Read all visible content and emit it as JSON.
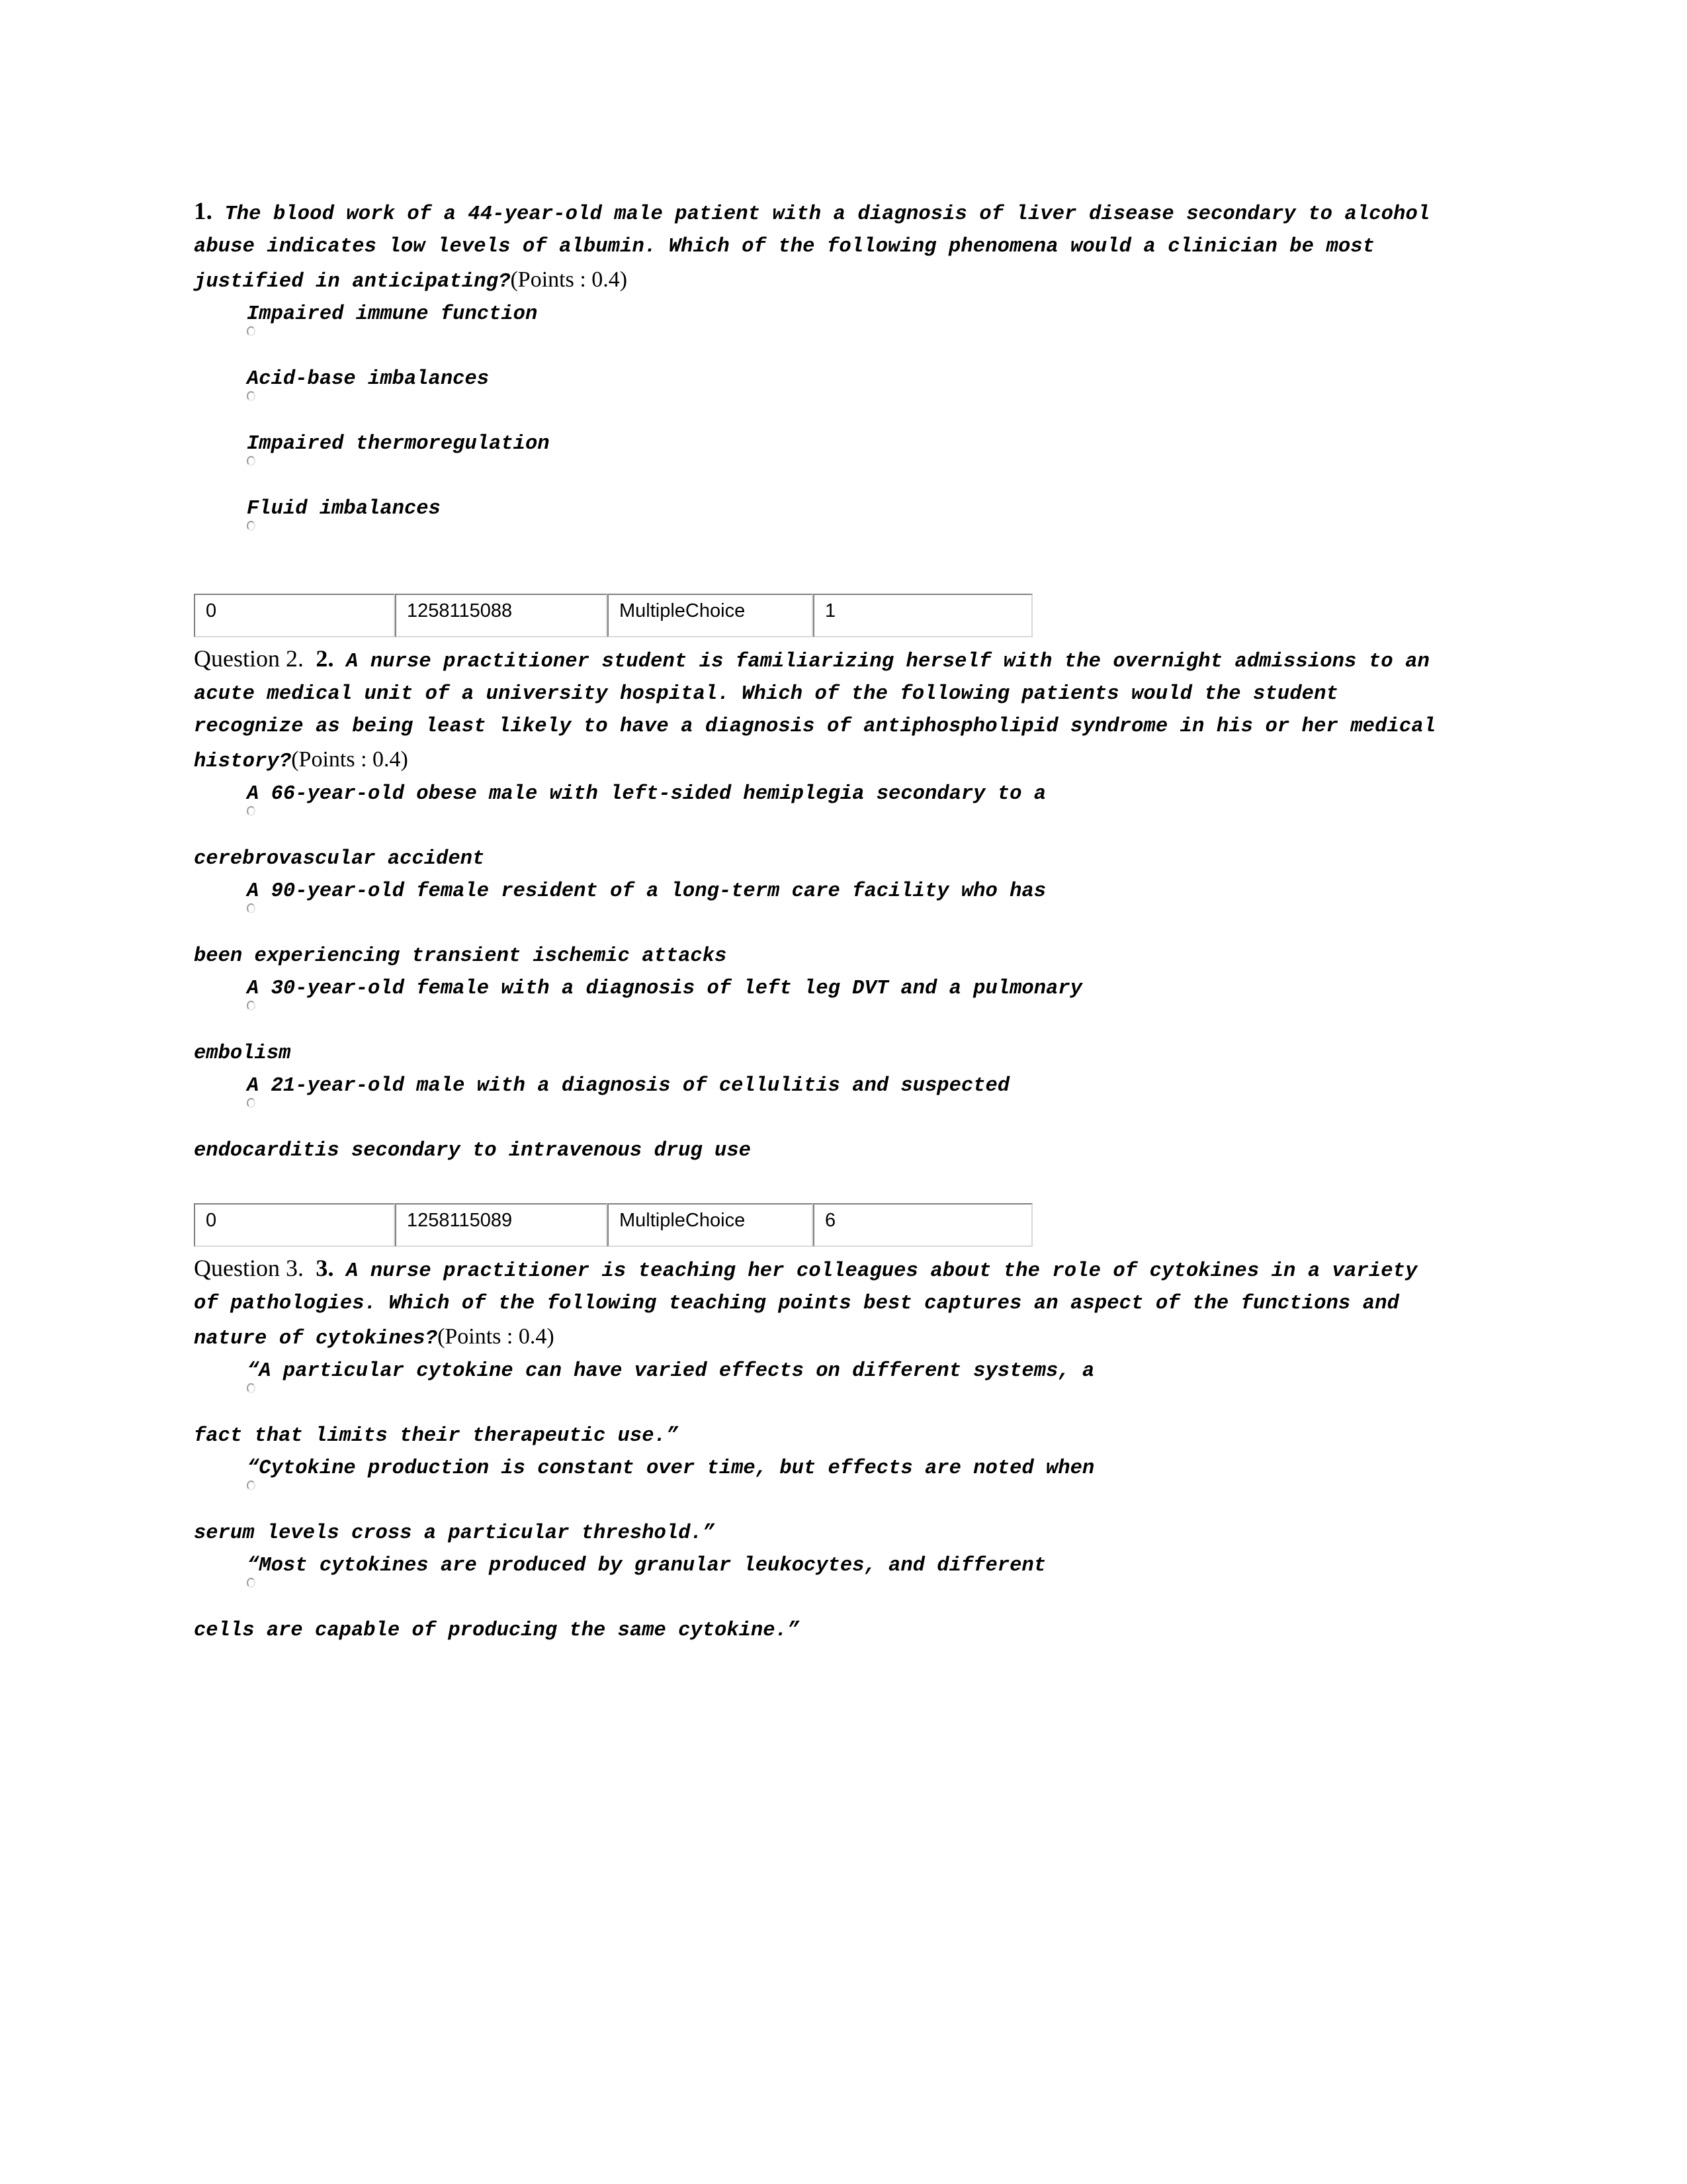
{
  "document": {
    "type": "quiz-answer-key",
    "points_label": "(Points : 0.4)"
  },
  "questions": [
    {
      "id": "q1",
      "label": "",
      "number": "1.",
      "stem": "The blood work of a 44-year-old male patient with a diagnosis of liver disease secondary to alcohol abuse indicates low levels of albumin. Which of the following phenomena would a clinician be most justified in anticipating?",
      "points": "(Points : 0.4)",
      "options": [
        {
          "text": "Impaired immune function",
          "wrapped": false,
          "tail": ""
        },
        {
          "text": "Acid-base imbalances",
          "wrapped": false,
          "tail": ""
        },
        {
          "text": "Impaired thermoregulation",
          "wrapped": false,
          "tail": ""
        },
        {
          "text": "Fluid imbalances",
          "wrapped": false,
          "tail": ""
        }
      ],
      "meta": {
        "col0": "0",
        "col1": "1258115088",
        "col2": "MultipleChoice",
        "col3": "1"
      }
    },
    {
      "id": "q2",
      "label": "Question 2.",
      "number": "2.",
      "stem": "A nurse practitioner student is familiarizing herself with the overnight admissions to an acute medical unit of a university hospital. Which of the following patients would the student recognize as being least likely to have a diagnosis of antiphospholipid syndrome in his or her medical history?",
      "points": "(Points : 0.4)",
      "options": [
        {
          "text": "A 66-year-old obese male with left-sided hemiplegia secondary to a",
          "wrapped": true,
          "tail": "cerebrovascular accident"
        },
        {
          "text": "A 90-year-old female resident of a long-term care facility who has",
          "wrapped": true,
          "tail": "been experiencing transient ischemic attacks"
        },
        {
          "text": "A 30-year-old female with a diagnosis of left leg DVT and a pulmonary",
          "wrapped": true,
          "tail": "embolism"
        },
        {
          "text": "A 21-year-old male with a diagnosis of cellulitis and suspected",
          "wrapped": true,
          "tail": "endocarditis secondary to intravenous drug use"
        }
      ],
      "meta": {
        "col0": "0",
        "col1": "1258115089",
        "col2": "MultipleChoice",
        "col3": "6"
      }
    },
    {
      "id": "q3",
      "label": "Question 3.",
      "number": "3.",
      "stem": "A nurse practitioner is teaching her colleagues about the role of cytokines in a variety of pathologies. Which of the following teaching points best captures an aspect of the functions and nature of cytokines?",
      "points": "(Points : 0.4)",
      "options": [
        {
          "text": "“A particular cytokine can have varied effects on different systems, a",
          "wrapped": true,
          "tail": "fact that limits their therapeutic use.”"
        },
        {
          "text": "“Cytokine production is constant over time, but effects are noted when",
          "wrapped": true,
          "tail": "serum levels cross a particular threshold.”"
        },
        {
          "text": "“Most cytokines are produced by granular leukocytes, and different",
          "wrapped": true,
          "tail": "cells are capable of producing the same cytokine.”"
        }
      ],
      "meta": null
    }
  ]
}
